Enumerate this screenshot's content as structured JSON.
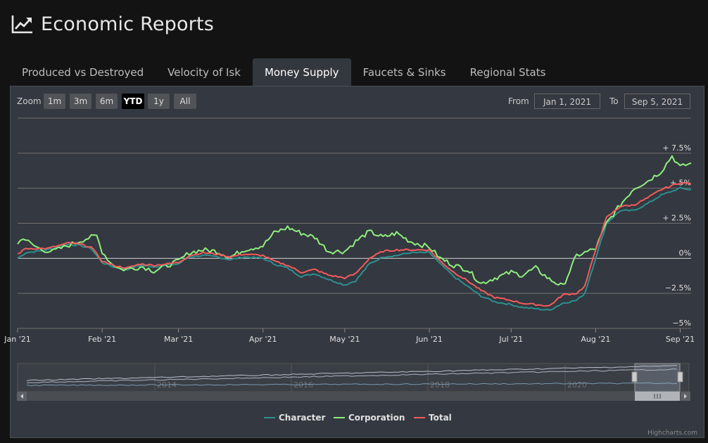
{
  "header": {
    "title": "Economic Reports",
    "icon": "line-chart-icon"
  },
  "tabs": [
    {
      "label": "Produced vs Destroyed"
    },
    {
      "label": "Velocity of Isk"
    },
    {
      "label": "Money Supply",
      "active": true
    },
    {
      "label": "Faucets & Sinks"
    },
    {
      "label": "Regional Stats"
    }
  ],
  "toolbar": {
    "zoom_label": "Zoom",
    "zoom_buttons": [
      "1m",
      "3m",
      "6m",
      "YTD",
      "1y",
      "All"
    ],
    "zoom_selected": "YTD",
    "from_label": "From",
    "from_value": "Jan 1, 2021",
    "to_label": "To",
    "to_value": "Sep 5, 2021"
  },
  "credit": "Highcharts.com",
  "colors": {
    "Character": "#2b908f",
    "Corporation": "#90ee7e",
    "Total": "#f45b5b",
    "background": "#343840",
    "page": "#131313"
  },
  "chart_data": {
    "type": "line",
    "title": "",
    "xlabel": "",
    "ylabel": "",
    "x_range": [
      "2021-01-01",
      "2021-09-05"
    ],
    "ylim": [
      -5,
      10
    ],
    "y_ticks": [
      -5,
      -2.5,
      0,
      2.5,
      5,
      7.5
    ],
    "y_tick_labels": [
      "−5%",
      "−2.5%",
      "0%",
      "+ 2.5%",
      "+ 5%",
      "+ 7.5%"
    ],
    "x_ticks": [
      "2021-01-01",
      "2021-02-01",
      "2021-03-01",
      "2021-04-01",
      "2021-05-01",
      "2021-06-01",
      "2021-07-01",
      "2021-08-01",
      "2021-09-01"
    ],
    "x_tick_labels": [
      "Jan '21",
      "Feb '21",
      "Mar '21",
      "Apr '21",
      "May '21",
      "Jun '21",
      "Jul '21",
      "Aug '21",
      "Sep '21"
    ],
    "grid": true,
    "legend_position": "bottom-center",
    "series": [
      {
        "name": "Character",
        "x": [
          "2021-01-01",
          "2021-01-04",
          "2021-01-08",
          "2021-01-12",
          "2021-01-16",
          "2021-01-20",
          "2021-01-24",
          "2021-01-28",
          "2021-02-01",
          "2021-02-05",
          "2021-02-10",
          "2021-02-15",
          "2021-02-20",
          "2021-02-25",
          "2021-03-01",
          "2021-03-05",
          "2021-03-10",
          "2021-03-15",
          "2021-03-20",
          "2021-03-25",
          "2021-04-01",
          "2021-04-05",
          "2021-04-10",
          "2021-04-15",
          "2021-04-20",
          "2021-04-25",
          "2021-05-01",
          "2021-05-05",
          "2021-05-10",
          "2021-05-15",
          "2021-05-20",
          "2021-05-25",
          "2021-06-01",
          "2021-06-05",
          "2021-06-10",
          "2021-06-15",
          "2021-06-20",
          "2021-06-25",
          "2021-07-01",
          "2021-07-05",
          "2021-07-10",
          "2021-07-15",
          "2021-07-20",
          "2021-07-25",
          "2021-07-28",
          "2021-08-01",
          "2021-08-05",
          "2021-08-10",
          "2021-08-15",
          "2021-08-20",
          "2021-08-25",
          "2021-09-01",
          "2021-09-05"
        ],
        "y": [
          0.0,
          0.4,
          0.5,
          0.6,
          0.8,
          1.0,
          0.9,
          0.7,
          -0.3,
          -0.6,
          -0.8,
          -0.5,
          -0.6,
          -0.5,
          -0.4,
          0.1,
          0.2,
          0.1,
          -0.1,
          0.1,
          0.0,
          -0.4,
          -0.7,
          -1.3,
          -1.1,
          -1.5,
          -1.9,
          -1.6,
          -0.4,
          0.1,
          0.2,
          0.4,
          0.4,
          -0.4,
          -1.3,
          -2.0,
          -2.7,
          -3.1,
          -3.3,
          -3.5,
          -3.6,
          -3.7,
          -3.2,
          -3.0,
          -2.5,
          0.0,
          2.5,
          3.4,
          3.4,
          3.9,
          4.5,
          5.0,
          4.9
        ]
      },
      {
        "name": "Corporation",
        "x": [
          "2021-01-01",
          "2021-01-03",
          "2021-01-06",
          "2021-01-10",
          "2021-01-14",
          "2021-01-18",
          "2021-01-22",
          "2021-01-26",
          "2021-01-30",
          "2021-02-01",
          "2021-02-04",
          "2021-02-08",
          "2021-02-12",
          "2021-02-16",
          "2021-02-20",
          "2021-02-25",
          "2021-03-01",
          "2021-03-05",
          "2021-03-10",
          "2021-03-15",
          "2021-03-20",
          "2021-03-25",
          "2021-04-01",
          "2021-04-05",
          "2021-04-10",
          "2021-04-15",
          "2021-04-20",
          "2021-04-25",
          "2021-05-01",
          "2021-05-05",
          "2021-05-10",
          "2021-05-15",
          "2021-05-20",
          "2021-05-25",
          "2021-06-01",
          "2021-06-05",
          "2021-06-10",
          "2021-06-15",
          "2021-06-20",
          "2021-06-25",
          "2021-07-01",
          "2021-07-05",
          "2021-07-10",
          "2021-07-15",
          "2021-07-20",
          "2021-07-25",
          "2021-07-28",
          "2021-08-01",
          "2021-08-05",
          "2021-08-10",
          "2021-08-15",
          "2021-08-20",
          "2021-08-25",
          "2021-08-29",
          "2021-09-01",
          "2021-09-05"
        ],
        "y": [
          1.0,
          1.5,
          1.0,
          0.6,
          0.5,
          0.8,
          1.1,
          1.4,
          1.6,
          0.5,
          -0.3,
          -0.8,
          -0.7,
          -0.6,
          -0.9,
          -0.5,
          -0.2,
          0.4,
          0.6,
          0.5,
          0.1,
          0.6,
          0.9,
          1.8,
          2.2,
          1.8,
          1.5,
          0.5,
          0.5,
          1.2,
          1.9,
          1.5,
          1.8,
          1.2,
          0.8,
          0.0,
          -0.5,
          -0.8,
          -1.8,
          -1.4,
          -1.0,
          -1.2,
          -0.7,
          -1.5,
          -2.0,
          0.2,
          0.4,
          0.7,
          2.5,
          3.8,
          5.0,
          5.5,
          6.2,
          7.3,
          6.5,
          6.8
        ]
      },
      {
        "name": "Total",
        "x": [
          "2021-01-01",
          "2021-01-04",
          "2021-01-08",
          "2021-01-12",
          "2021-01-16",
          "2021-01-20",
          "2021-01-24",
          "2021-01-28",
          "2021-02-01",
          "2021-02-05",
          "2021-02-10",
          "2021-02-15",
          "2021-02-20",
          "2021-02-25",
          "2021-03-01",
          "2021-03-05",
          "2021-03-10",
          "2021-03-15",
          "2021-03-20",
          "2021-03-25",
          "2021-04-01",
          "2021-04-05",
          "2021-04-10",
          "2021-04-15",
          "2021-04-20",
          "2021-04-25",
          "2021-05-01",
          "2021-05-05",
          "2021-05-10",
          "2021-05-15",
          "2021-05-20",
          "2021-05-25",
          "2021-06-01",
          "2021-06-05",
          "2021-06-10",
          "2021-06-15",
          "2021-06-20",
          "2021-06-25",
          "2021-07-01",
          "2021-07-05",
          "2021-07-10",
          "2021-07-15",
          "2021-07-20",
          "2021-07-25",
          "2021-07-28",
          "2021-08-01",
          "2021-08-05",
          "2021-08-10",
          "2021-08-15",
          "2021-08-20",
          "2021-08-25",
          "2021-09-01",
          "2021-09-05"
        ],
        "y": [
          0.3,
          0.7,
          0.7,
          0.7,
          0.9,
          1.1,
          1.0,
          0.8,
          -0.2,
          -0.5,
          -0.7,
          -0.4,
          -0.5,
          -0.4,
          -0.3,
          0.2,
          0.4,
          0.3,
          0.1,
          0.3,
          0.2,
          -0.2,
          -0.5,
          -1.0,
          -0.8,
          -1.2,
          -1.4,
          -1.1,
          0.0,
          0.5,
          0.6,
          0.6,
          0.6,
          -0.2,
          -1.0,
          -1.6,
          -2.3,
          -2.8,
          -3.0,
          -3.2,
          -3.3,
          -3.4,
          -2.6,
          -2.5,
          -2.0,
          0.6,
          2.9,
          3.7,
          3.8,
          4.3,
          4.9,
          5.4,
          5.3
        ]
      }
    ],
    "navigator": {
      "x_tick_labels": [
        "2014",
        "2016",
        "2018",
        "2020"
      ]
    }
  }
}
